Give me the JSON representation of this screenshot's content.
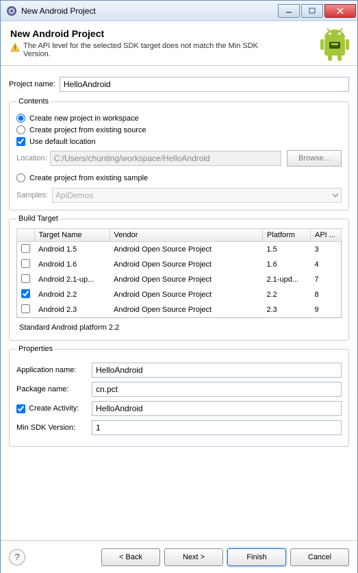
{
  "window": {
    "title": "New Android Project"
  },
  "header": {
    "title": "New Android Project",
    "warning": "The API level for the selected SDK target does not match the Min SDK Version."
  },
  "project": {
    "name_label": "Project name:",
    "name_value": "HelloAndroid"
  },
  "contents": {
    "legend": "Contents",
    "opt_new": "Create new project in workspace",
    "opt_existing": "Create project from existing source",
    "use_default": "Use default location",
    "location_label": "Location:",
    "location_value": "C:/Users/chunting/workspace/HelloAndroid",
    "browse_label": "Browse...",
    "opt_sample": "Create project from existing sample",
    "samples_label": "Samples:",
    "samples_value": "ApiDemos"
  },
  "build_target": {
    "legend": "Build Target",
    "columns": [
      "Target Name",
      "Vendor",
      "Platform",
      "API ..."
    ],
    "rows": [
      {
        "checked": false,
        "name": "Android 1.5",
        "vendor": "Android Open Source Project",
        "platform": "1.5",
        "api": "3"
      },
      {
        "checked": false,
        "name": "Android 1.6",
        "vendor": "Android Open Source Project",
        "platform": "1.6",
        "api": "4"
      },
      {
        "checked": false,
        "name": "Android 2.1-up...",
        "vendor": "Android Open Source Project",
        "platform": "2.1-upd...",
        "api": "7"
      },
      {
        "checked": true,
        "name": "Android 2.2",
        "vendor": "Android Open Source Project",
        "platform": "2.2",
        "api": "8"
      },
      {
        "checked": false,
        "name": "Android 2.3",
        "vendor": "Android Open Source Project",
        "platform": "2.3",
        "api": "9"
      }
    ],
    "hint": "Standard Android platform 2.2"
  },
  "properties": {
    "legend": "Properties",
    "app_name_label": "Application name:",
    "app_name_value": "HelloAndroid",
    "package_label": "Package name:",
    "package_value": "cn.pct",
    "create_activity_label": "Create Activity:",
    "create_activity_value": "HelloAndroid",
    "min_sdk_label": "Min SDK Version:",
    "min_sdk_value": "1"
  },
  "footer": {
    "back": "< Back",
    "next": "Next >",
    "finish": "Finish",
    "cancel": "Cancel"
  }
}
